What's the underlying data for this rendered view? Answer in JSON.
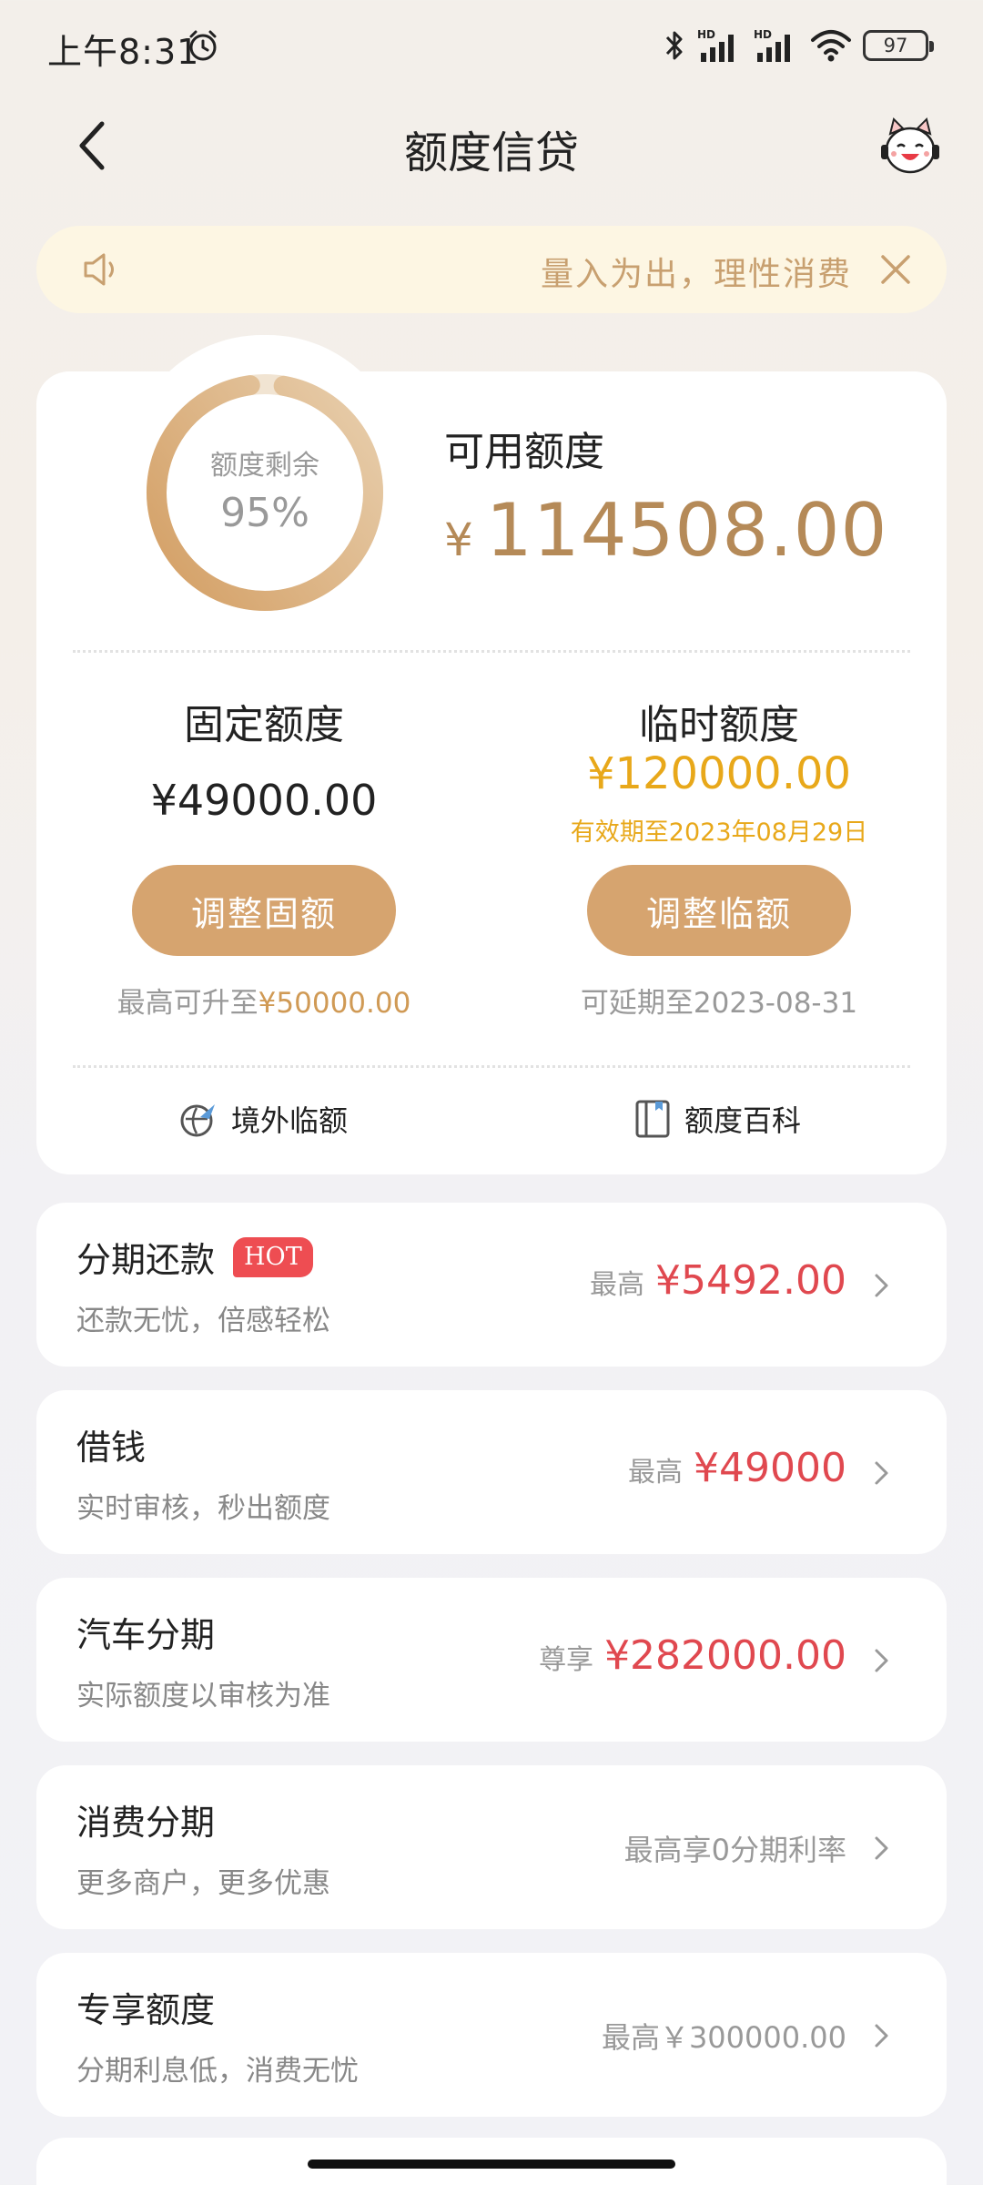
{
  "status_bar": {
    "time": "上午8:31",
    "icons": [
      "alarm-icon",
      "bluetooth-icon",
      "hd-signal-icon",
      "hd-signal-icon",
      "wifi-icon"
    ],
    "battery": "97"
  },
  "nav": {
    "title": "额度信贷",
    "back_icon": "chevron-left-icon",
    "mascot_icon": "mascot-icon"
  },
  "notice": {
    "text": "量入为出，理性消费"
  },
  "credit": {
    "ring_label": "额度剩余",
    "ring_percent": "95%",
    "ring_fraction": 0.95,
    "available_label": "可用额度",
    "available_currency": "¥",
    "available_amount": "114508.00",
    "fixed": {
      "title": "固定额度",
      "amount": "¥49000.00",
      "button": "调整固额",
      "note_prefix": "最高可升至",
      "note_value": "¥50000.00"
    },
    "temporary": {
      "title": "临时额度",
      "amount": "¥120000.00",
      "valid": "有效期至2023年08月29日",
      "button": "调整临额",
      "note": "可延期至2023-08-31"
    },
    "links": {
      "overseas": "境外临额",
      "wiki": "额度百科"
    }
  },
  "products": [
    {
      "title": "分期还款",
      "badge": "HOT",
      "subtitle": "还款无忧，倍感轻松",
      "prefix": "最高",
      "value": "¥5492.00"
    },
    {
      "title": "借钱",
      "subtitle": "实时审核，秒出额度",
      "prefix": "最高",
      "value": "¥49000"
    },
    {
      "title": "汽车分期",
      "subtitle": "实际额度以审核为准",
      "prefix": "尊享",
      "value": "¥282000.00"
    },
    {
      "title": "消费分期",
      "subtitle": "更多商户，更多优惠",
      "text": "最高享0分期利率"
    },
    {
      "title": "专享额度",
      "subtitle": "分期利息低，消费无忧",
      "text": "最高￥300000.00"
    }
  ],
  "colors": {
    "gold": "#d6a46f",
    "amount_gold": "#b58a58",
    "temp_yellow": "#e8a81a",
    "red": "#e0484f",
    "notice_bg": "#fdf6e3"
  }
}
